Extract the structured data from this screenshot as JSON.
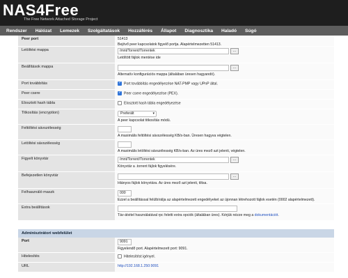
{
  "logo": {
    "title": "NAS4Free",
    "subtitle": "The Free Network Attached Storage Project"
  },
  "nav": [
    "Rendszer",
    "Hálózat",
    "Lemezek",
    "Szolgáltatások",
    "Hozzáférés",
    "Állapot",
    "Diagnosztika",
    "Haladó",
    "Súgó"
  ],
  "rows": {
    "peer_port": {
      "label": "Peer port",
      "value": "51413",
      "desc": "Bejövő peer kapcsolatok figyelő portja. Alapértelmezetten 51413."
    },
    "download_dir": {
      "label": "Letöltési mappa",
      "value": "/mnt/Torrent/Torrentek",
      "btn": "...",
      "desc": "Letöltött fájlok mentése ide"
    },
    "config_dir": {
      "label": "Beállítások mappa",
      "value": "",
      "btn": "...",
      "desc": "Alternatív konfigurációs mappa (általában üresen hagyandó)."
    },
    "port_forward": {
      "label": "Port továbbítás",
      "desc": "Port továbbítás engedélyezése NAT-PMP vagy UPnP által."
    },
    "peer_exchange": {
      "label": "Peer csere",
      "desc": "Peer csere engedélyezése (PEX)."
    },
    "dht": {
      "label": "Elosztott hash tábla",
      "desc": "Elosztott hash tábla engedélyezése"
    },
    "encryption": {
      "label": "Titkosítás (encryption)",
      "value": "Preferált",
      "desc": "A peer kapcsolat titkosítás módú."
    },
    "upload_speed": {
      "label": "Feltöltési sávszélesség",
      "value": "",
      "desc": "A maximális feltöltési sávszélesség KB/s-ban. Üresen hagyva végtelen."
    },
    "download_speed": {
      "label": "Letöltési sávszélesség",
      "value": "",
      "desc": "A maximális letöltési sávszélesség KB/s-ban. Az üres mező azt jelenti, végtelen."
    },
    "watch_dir": {
      "label": "Figyelt könyvtár",
      "value": "/mnt/Torrent/Torrentek",
      "btn": "...",
      "desc": "Könyvtár a .torrent fájlok figyelésére."
    },
    "incomplete_dir": {
      "label": "Befejezetlen könyvtár",
      "value": "",
      "btn": "...",
      "desc": "Hiányos fájlok könyvtára. Az üres mező azt jelenti, tiltsa."
    },
    "umask": {
      "label": "Felhasználó maszk",
      "value": "000",
      "desc": "Ezzel a beállítással felülbírálja az alapértelmezett engedélyeket az újonnan létrehozott fájlok esetén (0002 alapértelmezett)."
    },
    "extra_options": {
      "label": "Extra beállítások",
      "value": "",
      "desc": "Táv-átvitel használatával rpc feletti extra opciók (általában üres). Kérjük nézze meg a ",
      "link": "dokumentációt",
      "desc_end": "."
    }
  },
  "admin": {
    "title": "Adminisztrátori webfelület",
    "port": {
      "label": "Port",
      "value": "9091",
      "desc": "Figyelendő port. Alapértelmezett port: 9091."
    },
    "auth": {
      "label": "Hitelesítés",
      "desc": "Hitelesítést igényel."
    },
    "url": {
      "label": "URL",
      "value": "http://192.168.1.250:9091"
    }
  }
}
